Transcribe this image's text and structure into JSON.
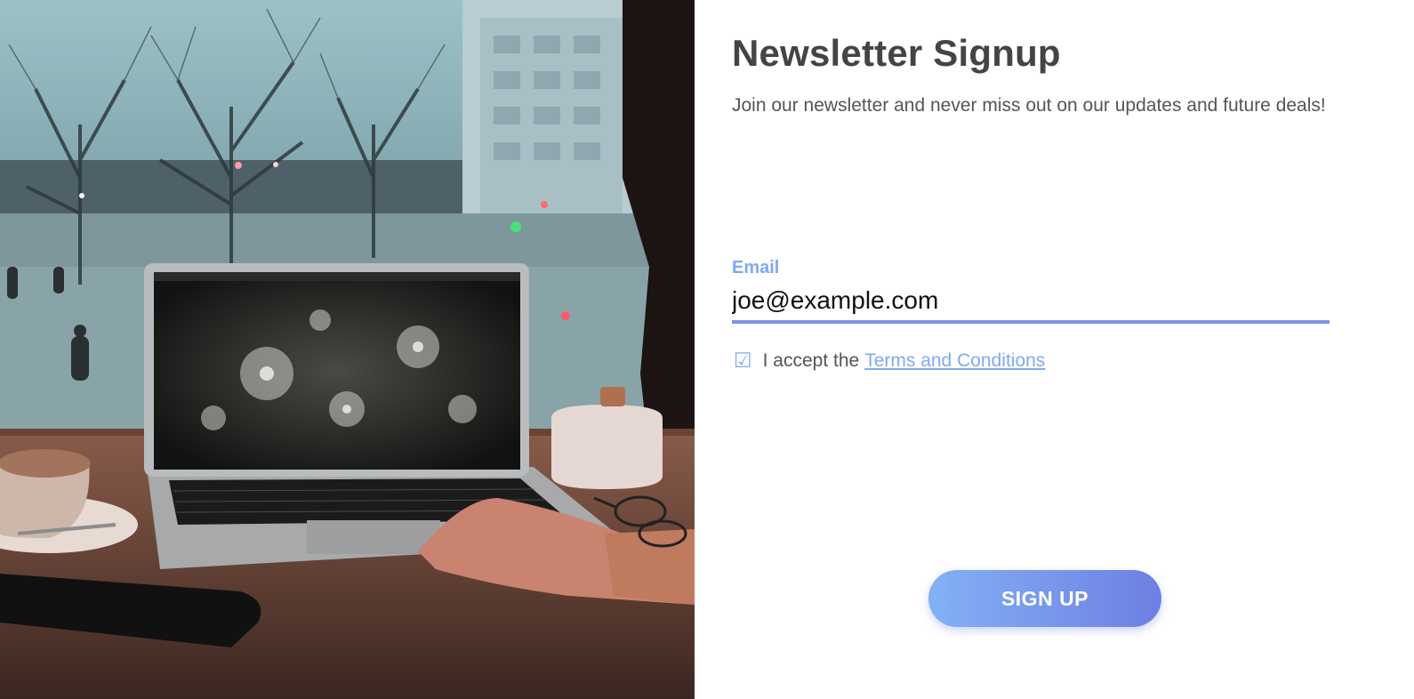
{
  "form": {
    "title": "Newsletter Signup",
    "subtitle": "Join our newsletter and never miss out on our updates and future deals!",
    "email_label": "Email",
    "email_value": "joe@example.com",
    "checkbox_symbol": "☑",
    "terms_prefix": "I accept the",
    "terms_link": "Terms and Conditions",
    "submit_label": "SIGN UP"
  },
  "colors": {
    "accent": "#7eaaf3",
    "accent_dark": "#6e7fe3",
    "title": "#444444",
    "text": "#555555"
  },
  "image": {
    "description_icon": "photo-laptop-cafe"
  }
}
